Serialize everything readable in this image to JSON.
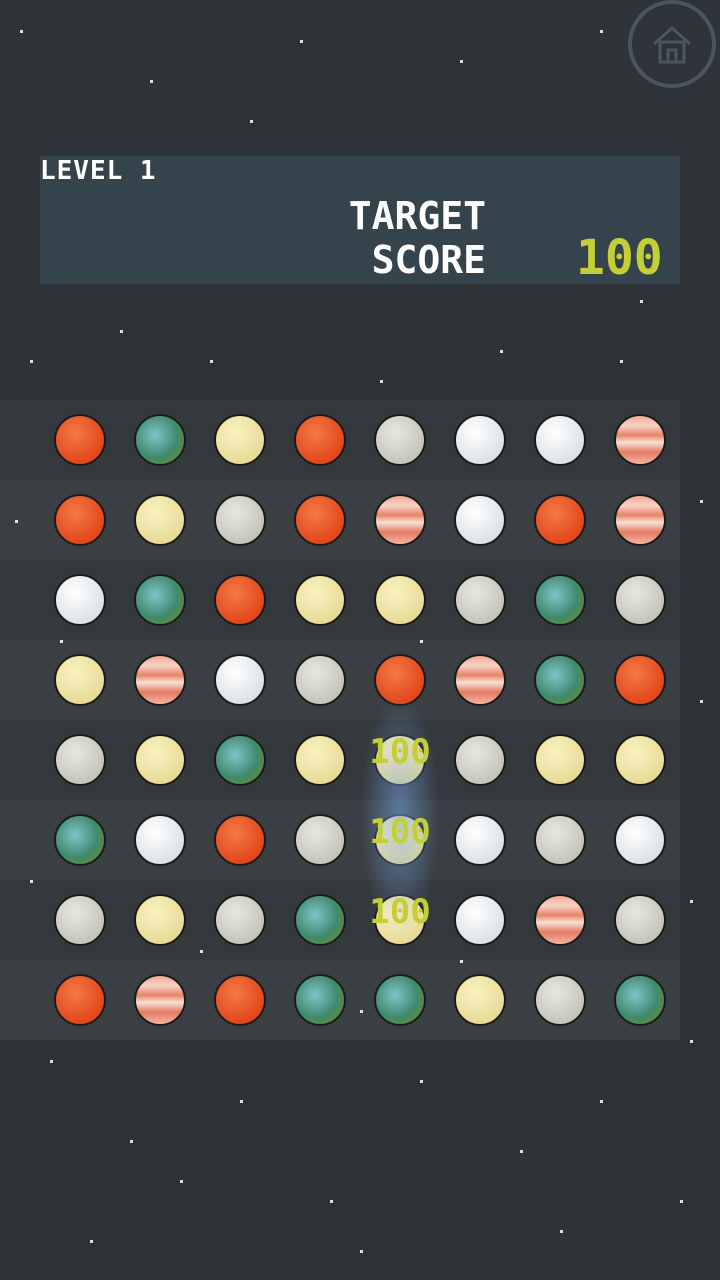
{
  "hud": {
    "level_label": "LEVEL 1",
    "target_label": "TARGET\nSCORE",
    "target_value": "100"
  },
  "home_button": {
    "icon": "home-icon"
  },
  "board": {
    "rows": [
      [
        "mars",
        "earth",
        "venus",
        "mars",
        "moon",
        "ice",
        "ice",
        "jupiter"
      ],
      [
        "mars",
        "venus",
        "moon",
        "mars",
        "jupiter",
        "ice",
        "mars",
        "jupiter"
      ],
      [
        "ice",
        "earth",
        "mars",
        "venus",
        "venus",
        "moon",
        "earth",
        "moon"
      ],
      [
        "venus",
        "jupiter",
        "ice",
        "moon",
        "mars",
        "jupiter",
        "earth",
        "mars"
      ],
      [
        "moon",
        "venus",
        "earth",
        "venus",
        "venus",
        "moon",
        "venus",
        "venus"
      ],
      [
        "earth",
        "ice",
        "mars",
        "moon",
        "venus",
        "ice",
        "moon",
        "ice"
      ],
      [
        "moon",
        "venus",
        "moon",
        "earth",
        "venus",
        "ice",
        "jupiter",
        "moon"
      ],
      [
        "mars",
        "jupiter",
        "mars",
        "earth",
        "earth",
        "venus",
        "moon",
        "earth"
      ]
    ]
  },
  "score_popups": [
    {
      "text": "100",
      "row": 4,
      "col": 4
    },
    {
      "text": "100",
      "row": 5,
      "col": 4
    },
    {
      "text": "100",
      "row": 6,
      "col": 4
    }
  ],
  "colors": {
    "accent": "#c4cf36",
    "panel": "#35434c",
    "background": "#2e3338"
  }
}
